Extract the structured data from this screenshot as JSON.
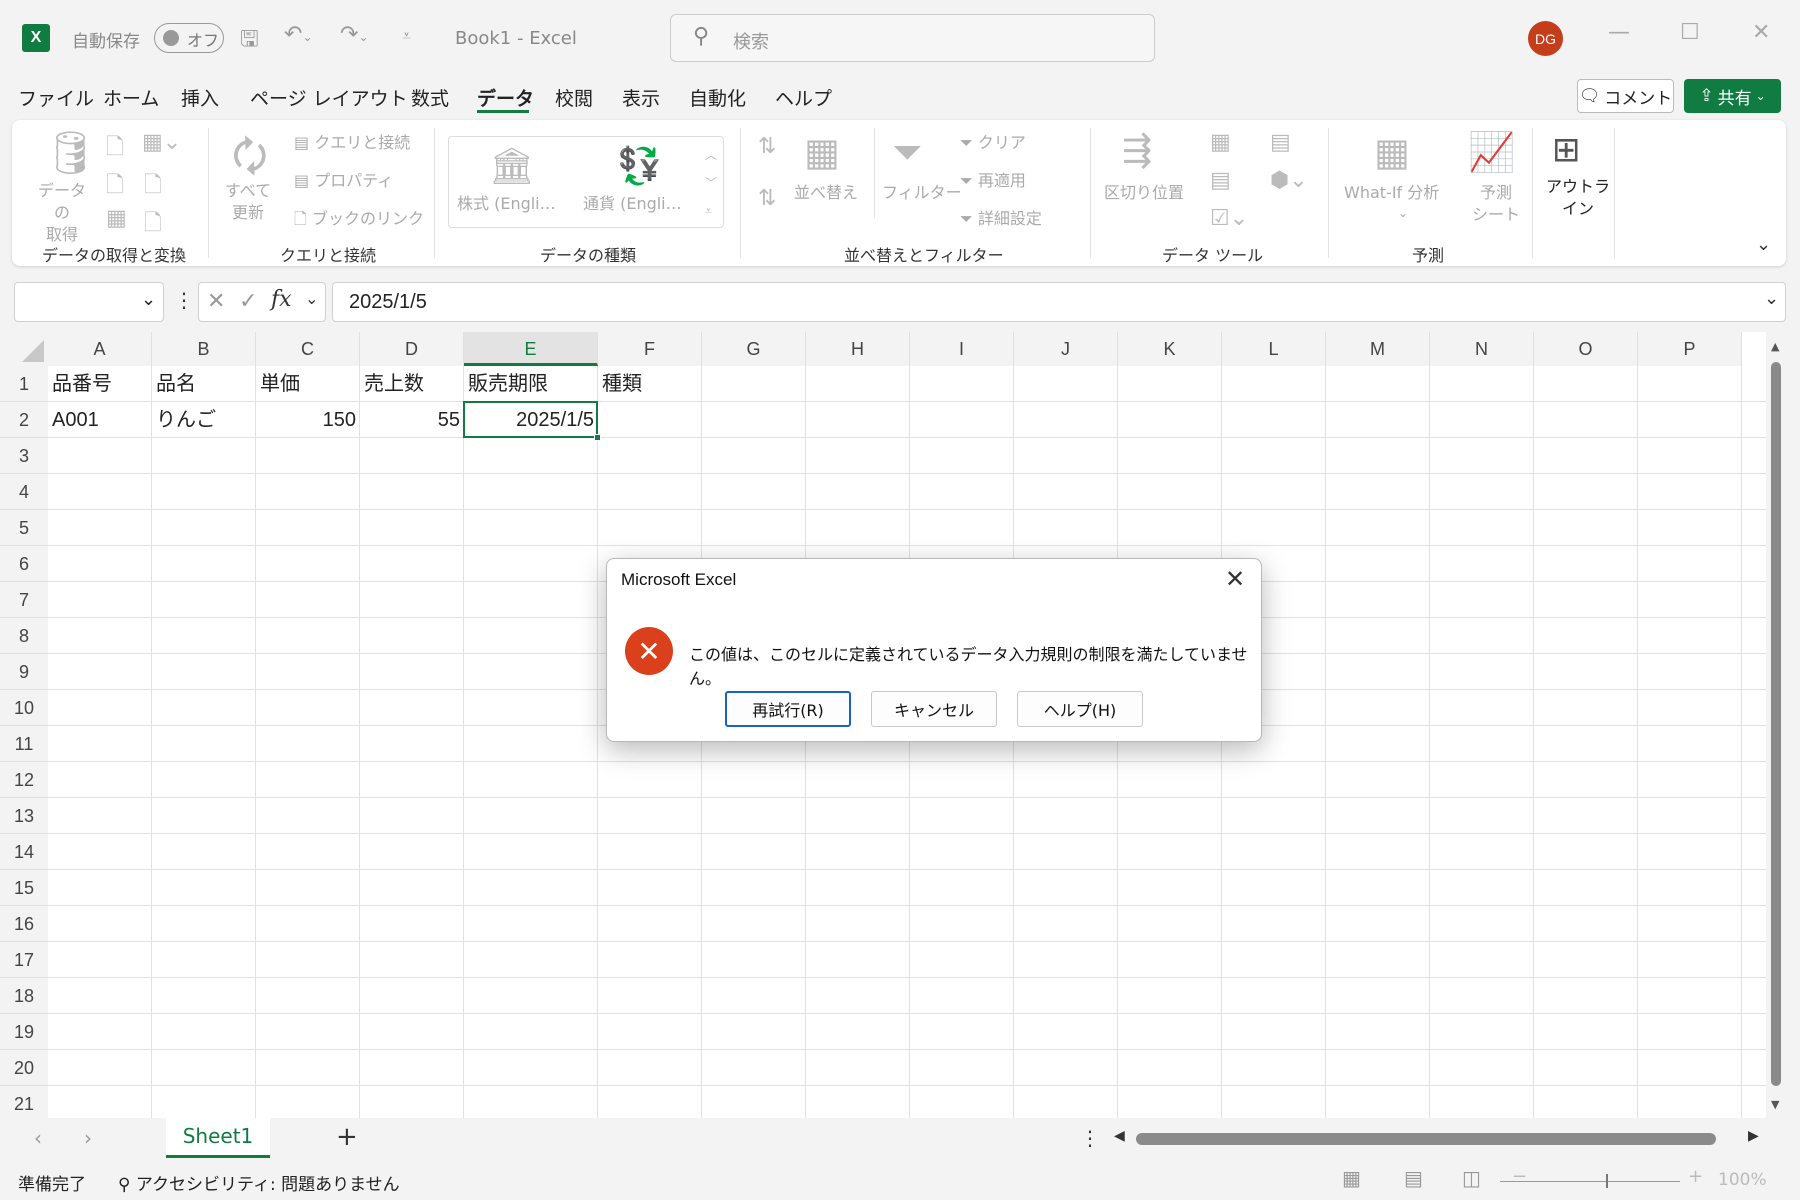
{
  "titlebar": {
    "logo": "X",
    "autosave_label": "自動保存",
    "autosave_state": "オフ",
    "doc_title": "Book1  -  Excel",
    "search_placeholder": "検索",
    "avatar_initials": "DG"
  },
  "tabs": [
    "ファイル",
    "ホーム",
    "挿入",
    "ページ レイアウト",
    "数式",
    "データ",
    "校閲",
    "表示",
    "自動化",
    "ヘルプ"
  ],
  "active_tab": "データ",
  "actions": {
    "comment": "コメント",
    "share": "共有"
  },
  "ribbon": {
    "get_data": "データの\n取得",
    "refresh_all": "すべて\n更新",
    "queries_connections": "クエリと接続",
    "properties": "プロパティ",
    "edit_links": "ブックのリンク",
    "stocks": "株式 (Engli…",
    "currencies": "通貨 (Engli…",
    "sort": "並べ替え",
    "filter": "フィルター",
    "clear": "クリア",
    "reapply": "再適用",
    "advanced": "詳細設定",
    "text_to_columns": "区切り位置",
    "what_if": "What-If 分析",
    "forecast_sheet": "予測\nシート",
    "outline": "アウトラ\nイン",
    "groups": {
      "get_transform": "データの取得と変換",
      "queries": "クエリと接続",
      "data_types": "データの種類",
      "sort_filter": "並べ替えとフィルター",
      "data_tools": "データ ツール",
      "forecast": "予測"
    }
  },
  "formula_bar": {
    "name_box": "",
    "value": "2025/1/5"
  },
  "columns": [
    "A",
    "B",
    "C",
    "D",
    "E",
    "F",
    "G",
    "H",
    "I",
    "J",
    "K",
    "L",
    "M",
    "N",
    "O",
    "P"
  ],
  "rows": [
    "1",
    "2",
    "3",
    "4",
    "5",
    "6",
    "7",
    "8",
    "9",
    "10",
    "11",
    "12",
    "13",
    "14",
    "15",
    "16",
    "17",
    "18",
    "19",
    "20",
    "21"
  ],
  "cells": {
    "A1": "品番号",
    "B1": "品名",
    "C1": "単価",
    "D1": "売上数",
    "E1": "販売期限",
    "F1": "種類",
    "A2": "A001",
    "B2": "りんご",
    "C2": "150",
    "D2": "55",
    "E2": "2025/1/5"
  },
  "sheets": [
    "Sheet1"
  ],
  "status": {
    "ready": "準備完了",
    "accessibility": "アクセシビリティ: 問題ありません",
    "zoom": "100%"
  },
  "dialog": {
    "title": "Microsoft Excel",
    "message": "この値は、このセルに定義されているデータ入力規則の制限を満たしていません。",
    "retry": "再試行(R)",
    "cancel": "キャンセル",
    "help": "ヘルプ(H)"
  }
}
